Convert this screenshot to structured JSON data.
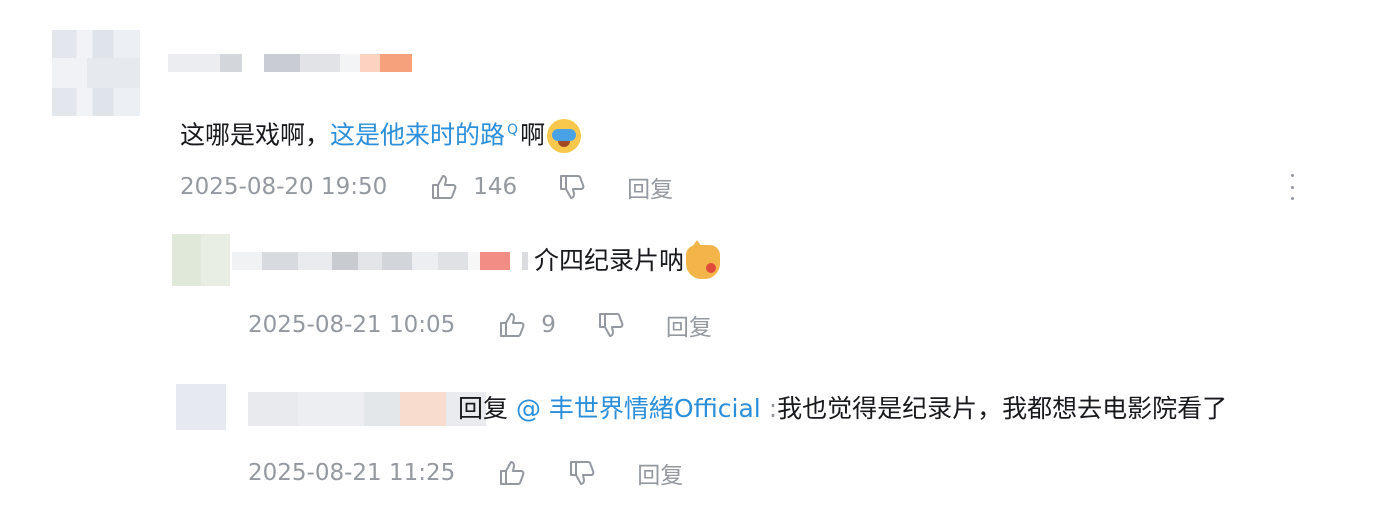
{
  "comment": {
    "text_plain": "这哪是戏啊，",
    "text_link": "这是他来时的路",
    "search_glyph": "Q",
    "text_after": "啊",
    "emoji": "crying-laughing-emoji",
    "time": "2025-08-20 19:50",
    "likes": "146",
    "reply_label": "回复"
  },
  "replies": [
    {
      "text": "介四纪录片呐",
      "emoji": "cat-emoji",
      "time": "2025-08-21 10:05",
      "likes": "9",
      "reply_label": "回复"
    },
    {
      "prefix": "回复",
      "mention": "@ 丰世界情緒Official",
      "separator": ":",
      "text": "我也觉得是纪录片，我都想去电影院看了",
      "time": "2025-08-21 11:25",
      "likes": "",
      "reply_label": "回复"
    }
  ],
  "colors": {
    "link": "#2c8fdb",
    "meta": "#9499a0",
    "text": "#18191c"
  }
}
